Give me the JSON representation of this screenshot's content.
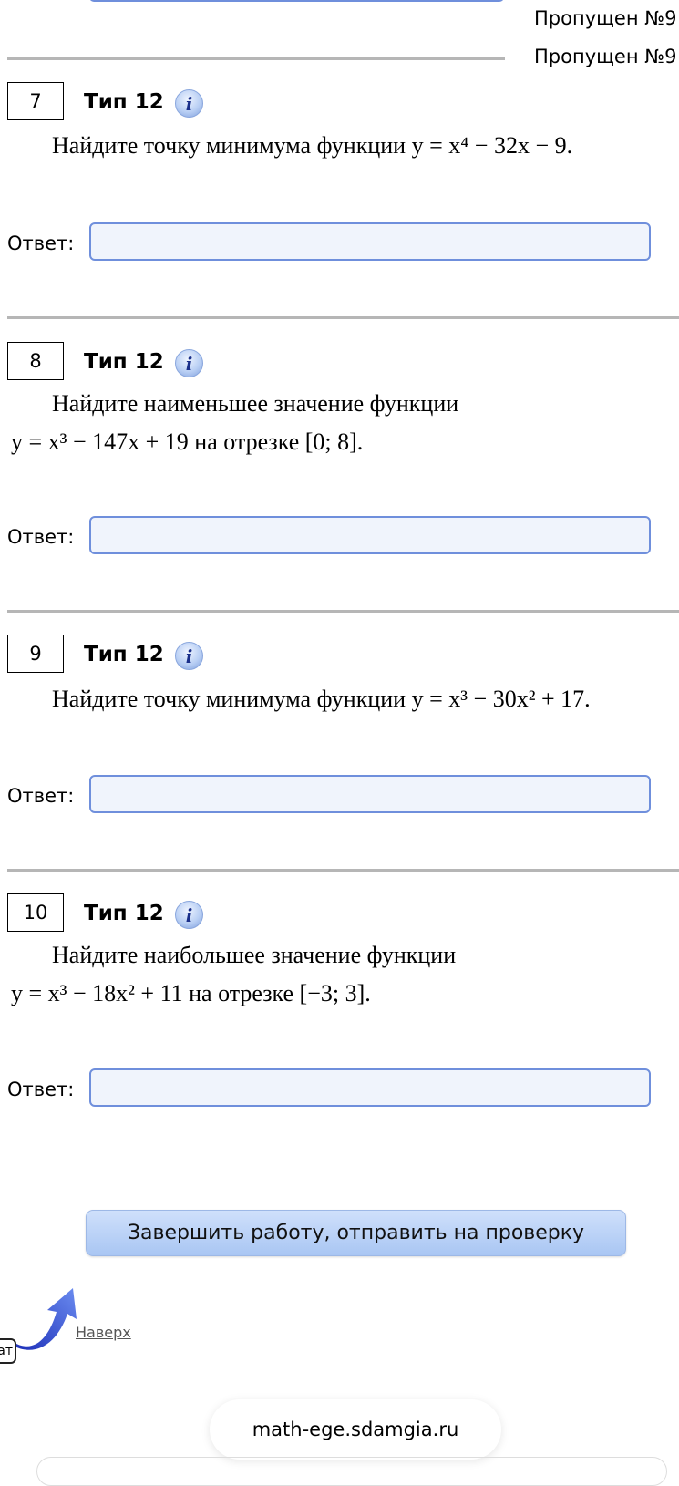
{
  "skipped_lines": [
    "Пропущен №9",
    "Пропущен №9"
  ],
  "tasks": [
    {
      "number": "7",
      "type": "Тип 12",
      "info": "i",
      "lines": [
        "Найдите точку минимума функции y = x⁴ − 32x − 9."
      ],
      "answer_label": "Ответ:",
      "answer_value": ""
    },
    {
      "number": "8",
      "type": "Тип 12",
      "info": "i",
      "lines": [
        "Найдите наименьшее значение функции",
        "y = x³ − 147x + 19 на отрезке [0; 8]."
      ],
      "answer_label": "Ответ:",
      "answer_value": ""
    },
    {
      "number": "9",
      "type": "Тип 12",
      "info": "i",
      "lines": [
        "Найдите точку минимума функции y = x³ − 30x² + 17."
      ],
      "answer_label": "Ответ:",
      "answer_value": ""
    },
    {
      "number": "10",
      "type": "Тип 12",
      "info": "i",
      "lines": [
        "Найдите наибольшее значение функции",
        "y = x³ − 18x² + 11 на отрезке [−3; 3]."
      ],
      "answer_label": "Ответ:",
      "answer_value": ""
    }
  ],
  "submit_label": "Завершить работу, отправить на проверку",
  "top_link": "Наверх",
  "chat_tab": "ат",
  "url": "math-ege.sdamgia.ru"
}
